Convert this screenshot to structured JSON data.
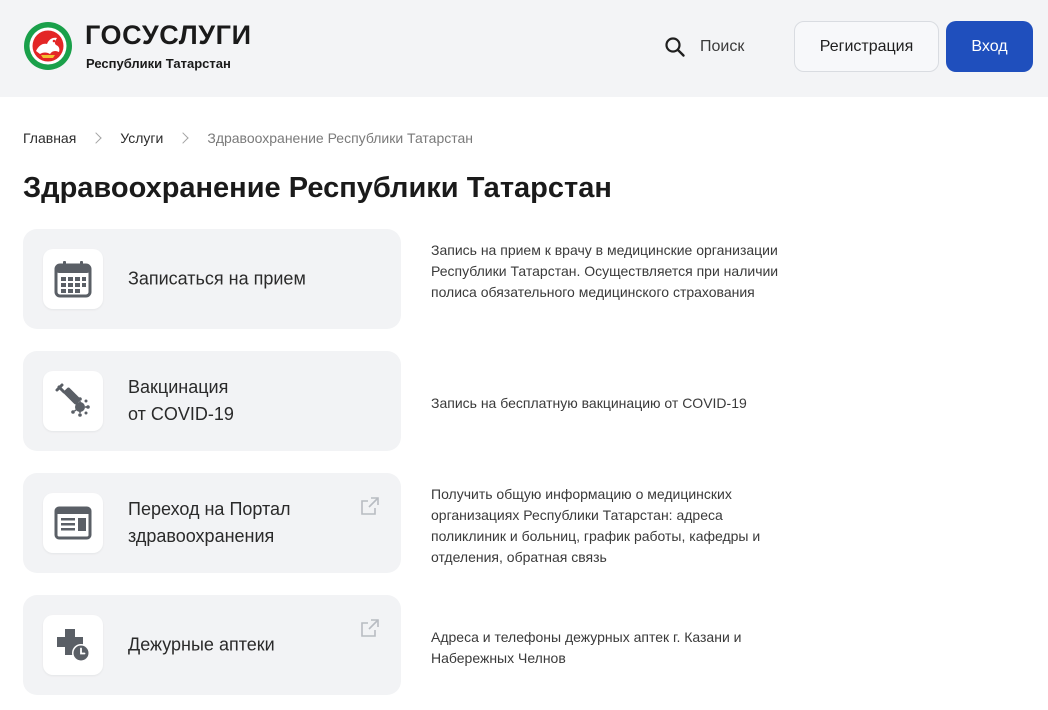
{
  "header": {
    "brand_title": "ГОСУСЛУГИ",
    "brand_subtitle": "Республики Татарстан",
    "search_label": "Поиск",
    "register_label": "Регистрация",
    "login_label": "Вход",
    "login_color": "#1f4fbd"
  },
  "breadcrumb": [
    "Главная",
    "Услуги",
    "Здравоохранение Республики Татарстан"
  ],
  "page_title": "Здравоохранение Республики Татарстан",
  "services": [
    {
      "icon": "calendar-icon",
      "label": "Записаться на прием",
      "external": false,
      "description": "Запись на прием к врачу в медицинские организации Республики Татарстан. Осуществляется при наличии полиса обязательного медицинского страхования"
    },
    {
      "icon": "vaccine-syringe-icon",
      "label": "Вакцинация\nот COVID-19",
      "external": false,
      "description": "Запись на бесплатную вакцинацию от COVID-19"
    },
    {
      "icon": "portal-document-icon",
      "label": "Переход на Портал\nздравоохранения",
      "external": true,
      "description": "Получить общую информацию о медицинских организациях Республики Татарстан: адреса поликлиник и больниц, график работы, кафедры и отделения, обратная связь"
    },
    {
      "icon": "pharmacy-cross-clock-icon",
      "label": "Дежурные аптеки",
      "external": true,
      "description": "Адреса и телефоны дежурных аптек г. Казани и Набережных Челнов"
    }
  ]
}
